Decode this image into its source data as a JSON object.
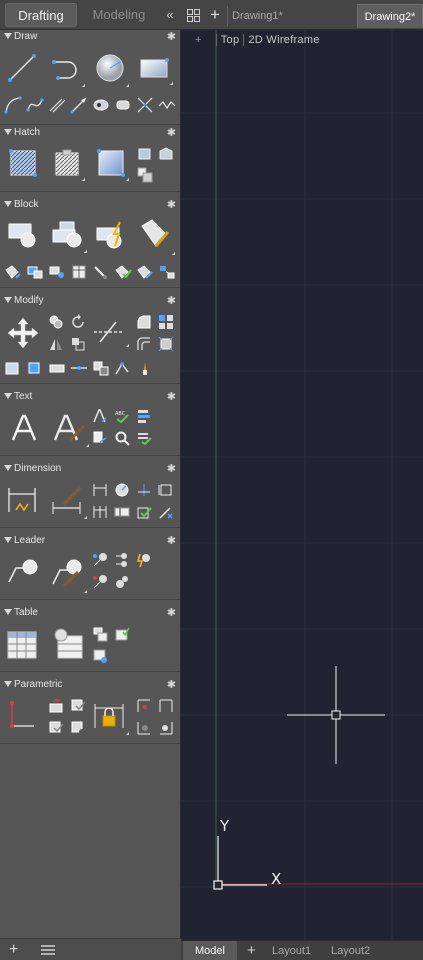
{
  "palette": {
    "tabs": [
      "Drafting",
      "Modeling"
    ],
    "active_tab": "Drafting",
    "collapse_label": "«",
    "sections": {
      "draw": "Draw",
      "hatch": "Hatch",
      "block": "Block",
      "modify": "Modify",
      "text": "Text",
      "dimension": "Dimension",
      "leader": "Leader",
      "table": "Table",
      "parametric": "Parametric"
    },
    "footer": {
      "add_label": "+"
    }
  },
  "documents": {
    "new_tab_label": "+",
    "tabs": [
      "Drawing1*",
      "Drawing2*"
    ],
    "active": "Drawing2*"
  },
  "viewport": {
    "plus_label": "+",
    "view": "Top",
    "visual_style": "2D Wireframe",
    "ucs_y": "Y",
    "ucs_x": "X"
  },
  "layouts": {
    "tabs": [
      "Model",
      "Layout1",
      "Layout2"
    ],
    "active": "Model",
    "add_label": "+"
  },
  "colors": {
    "viewport_bg": "#212330",
    "grid_line": "#2c2f3d",
    "x_axis": "#8b2a2a",
    "y_axis": "#2a6b3a",
    "palette_bg": "#565656"
  }
}
